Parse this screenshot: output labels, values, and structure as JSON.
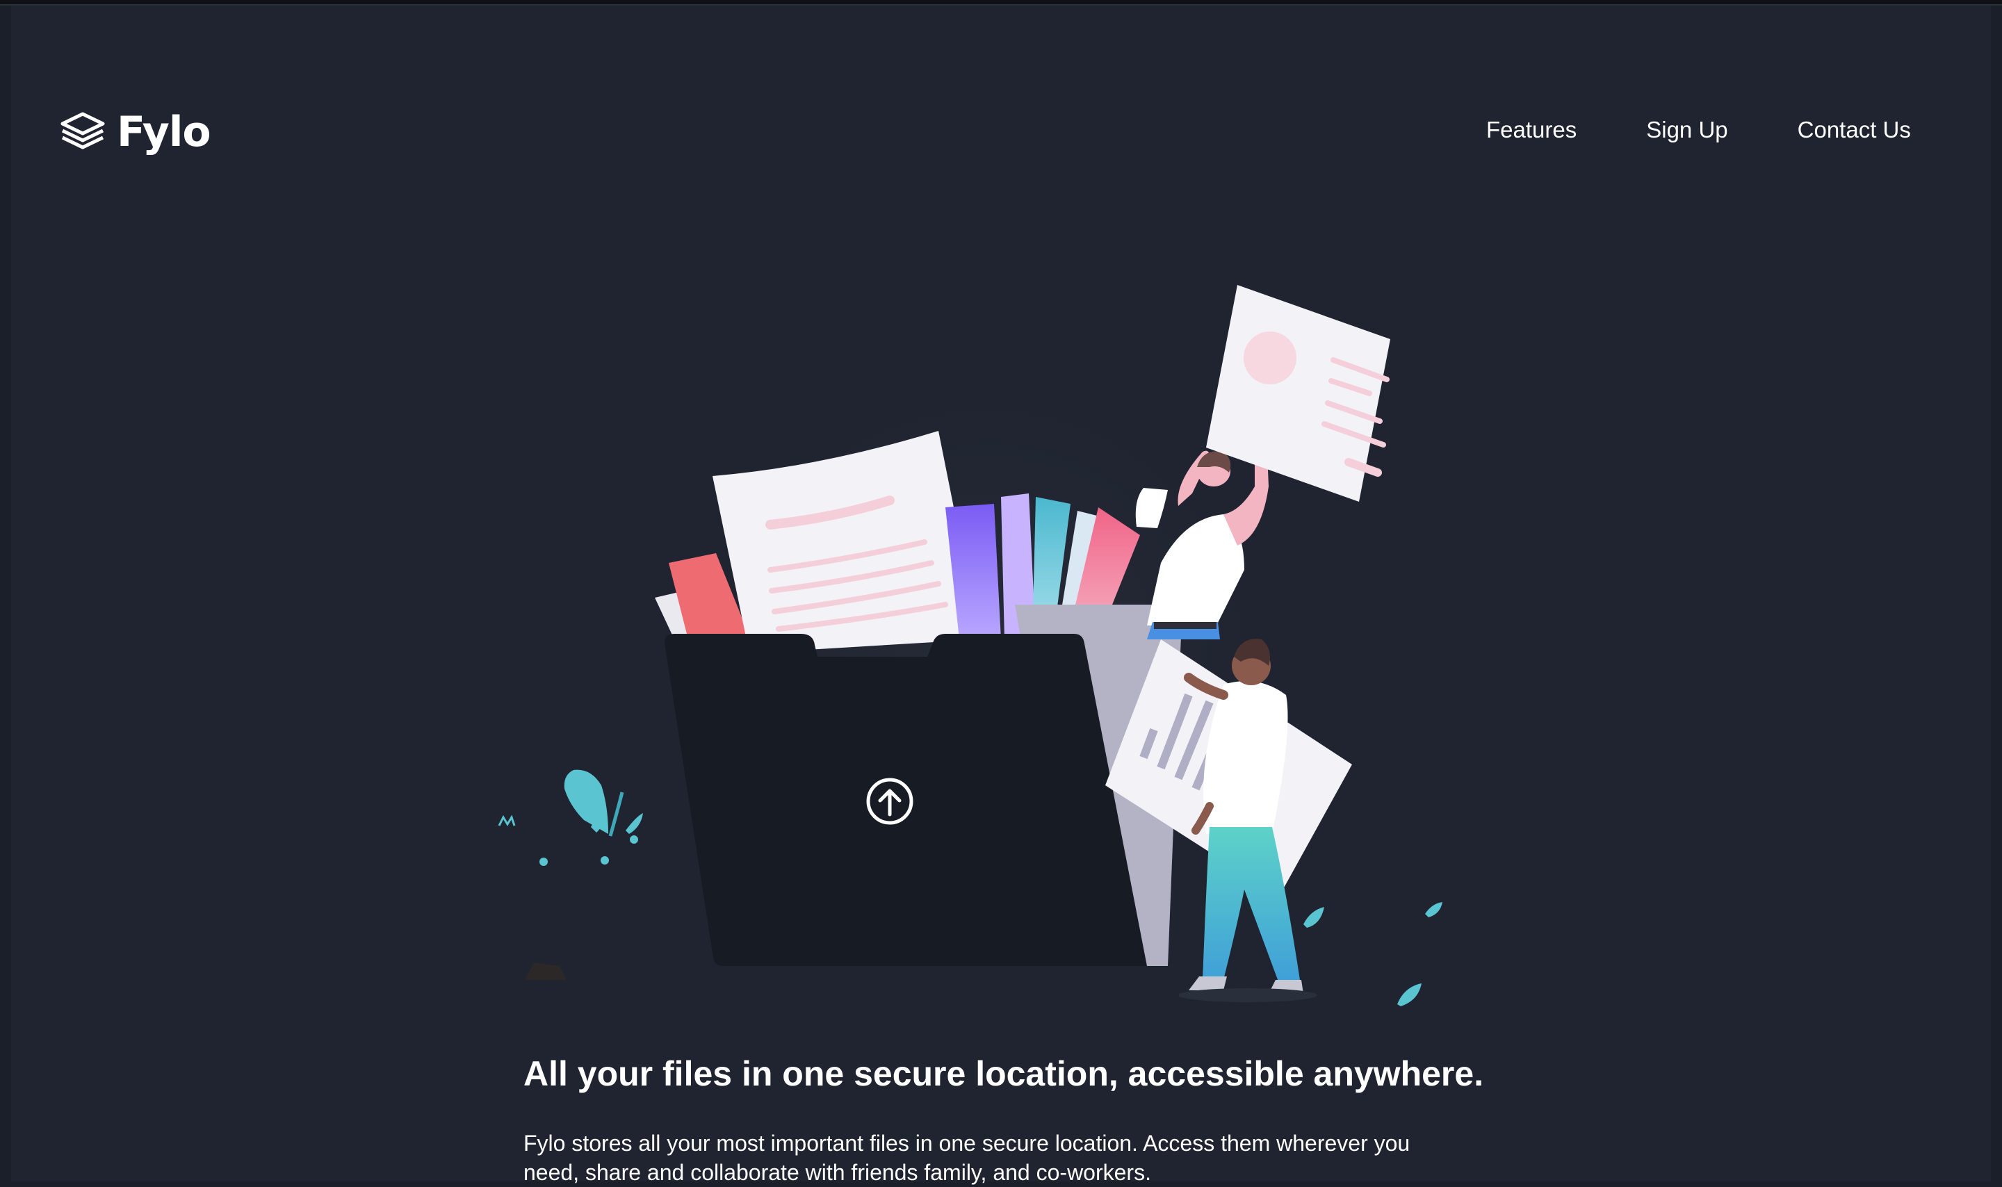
{
  "brand": {
    "name": "Fylo",
    "logo_icon": "stacked-layers-icon"
  },
  "nav": {
    "items": [
      {
        "label": "Features"
      },
      {
        "label": "Sign Up"
      },
      {
        "label": "Contact Us"
      }
    ]
  },
  "hero": {
    "illustration": "file-upload-illustration",
    "upload_icon": "upload-arrow-icon",
    "headline": "All your files in one secure location, accessible anywhere.",
    "description": "Fylo stores all your most important files in one secure location. Access them wherever you need, share and collaborate with friends family, and co-workers."
  },
  "colors": {
    "background": "#1f2430",
    "folder": "#181c26",
    "text": "#ffffff",
    "accent_teal": "#5bc4d1",
    "accent_pink": "#ef6b8a"
  }
}
